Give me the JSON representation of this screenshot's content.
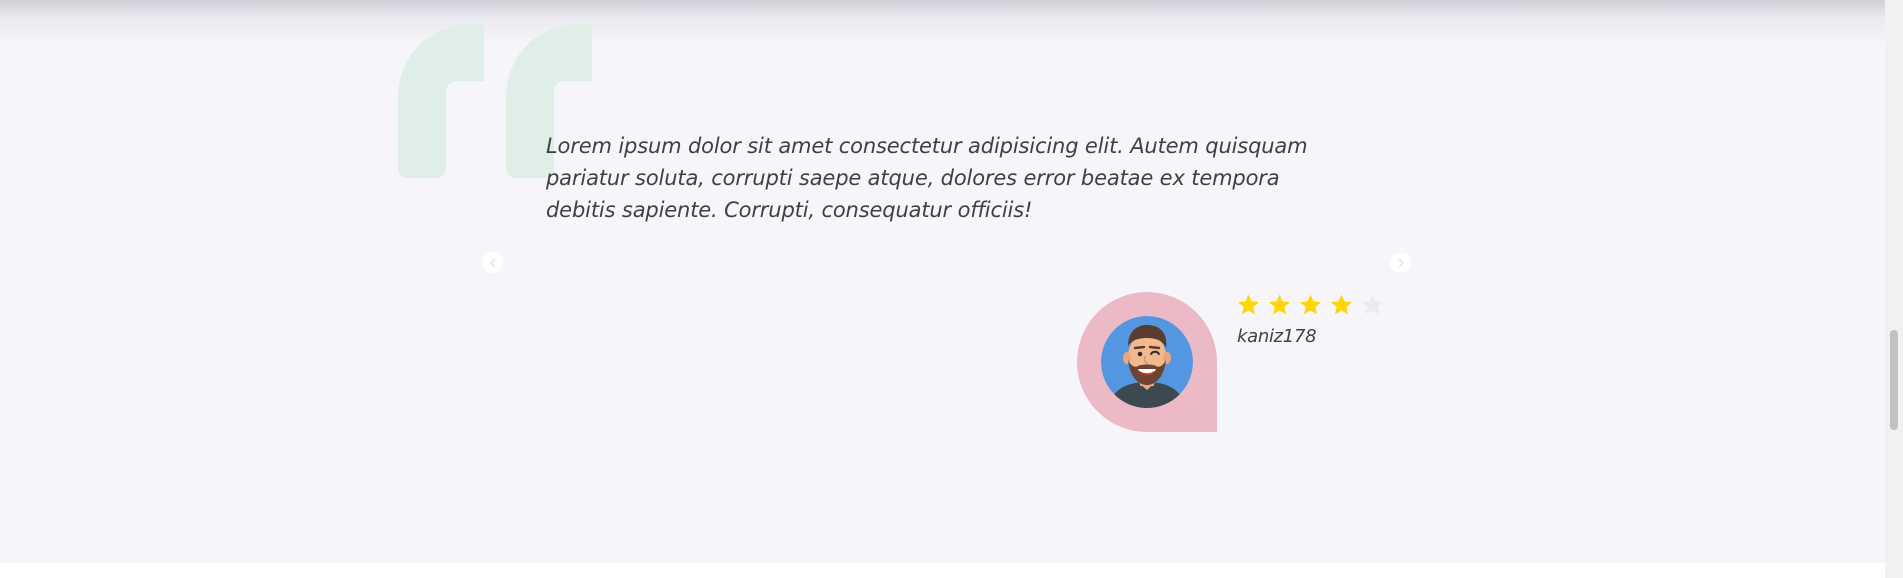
{
  "testimonial": {
    "quote_icon": "quote-left-icon",
    "text": "Lorem ipsum dolor sit amet consectetur adipisicing elit. Autem quisquam pariatur soluta, corrupti saepe atque, dolores error beatae ex tempora debitis sapiente. Corrupti, consequatur officiis!",
    "author": {
      "name": "kaniz178",
      "avatar_icon": "man-avatar-icon"
    },
    "rating": {
      "value": 4,
      "max": 5
    }
  },
  "slider": {
    "prev_icon": "chevron-left-icon",
    "next_icon": "chevron-right-icon"
  },
  "colors": {
    "background": "#f6f5fa",
    "quote_icon": "#dfeee7",
    "avatar_bubble": "#ecb9c6",
    "avatar_bg": "#5397e0",
    "star_filled": "#fcd605",
    "star_empty": "#ebebef",
    "text": "#3f3f46"
  }
}
